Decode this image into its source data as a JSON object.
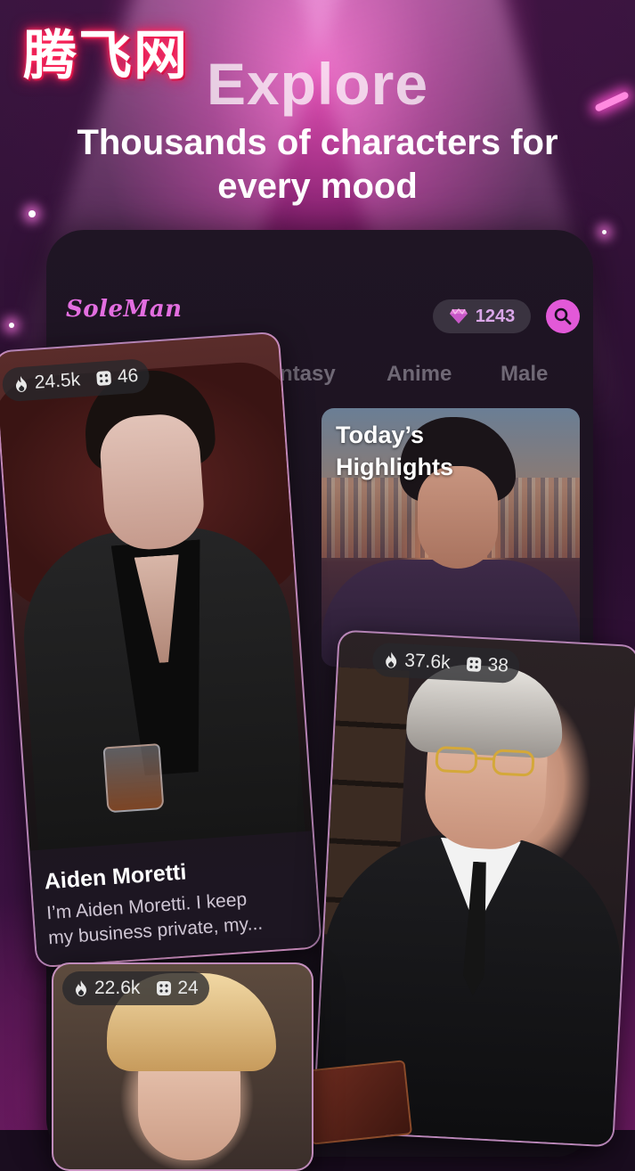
{
  "watermark": "腾飞网",
  "hero": {
    "title": "Explore",
    "subtitle_line1": "Thousands of characters for",
    "subtitle_line2": "every mood"
  },
  "app": {
    "brand": "SoleMan",
    "gems": "1243",
    "icons": {
      "gem": "diamond-icon",
      "search": "search-icon",
      "fire": "fire-icon",
      "dice": "dice-icon"
    },
    "tabs": [
      "ntasy",
      "Anime",
      "Male"
    ],
    "highlights": {
      "title_line1": "Today’s",
      "title_line2": "Highlights"
    }
  },
  "cards": [
    {
      "likes": "24.5k",
      "count": "46",
      "name": "Aiden Moretti",
      "description_line1": "I’m Aiden Moretti. I keep",
      "description_line2": "my business private, my..."
    },
    {
      "likes": "37.6k",
      "count": "38"
    },
    {
      "likes": "22.6k",
      "count": "24"
    }
  ],
  "colors": {
    "accent": "#e259d8",
    "brand": "#e36ee0",
    "watermark_glow": "#ff2a5e",
    "card_bg": "#1d1622"
  }
}
